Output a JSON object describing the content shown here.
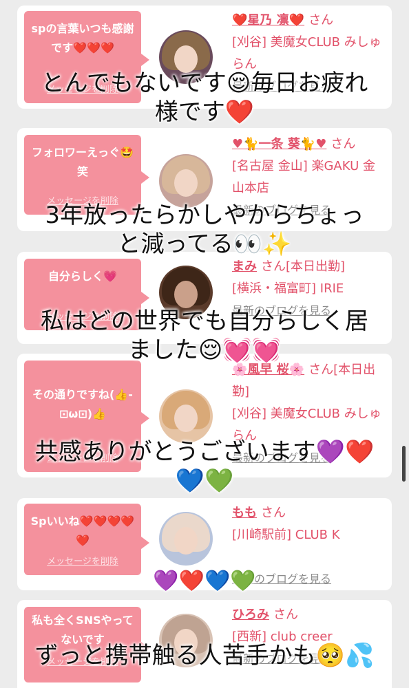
{
  "cards": [
    {
      "message": "spの言葉いつも感謝です❤️❤️❤️",
      "delete_label": "メッセージを削除",
      "name": "❤️星乃 凛❤️",
      "san": "さん",
      "shop": "[刈谷] 美魔女CLUB みしゅらん",
      "blog": "最新のブログを見る",
      "avatar_color": "#6a4b5c"
    },
    {
      "message": "フォロワーえっぐ🤩笑",
      "delete_label": "メッセージを削除",
      "name": "♥🐈一条 葵🐈♥",
      "san": "さん",
      "shop": "[名古屋 金山] 楽GAKU 金山本店",
      "blog": "最新のブログを見る",
      "avatar_color": "#c6a39b"
    },
    {
      "message": "自分らしく💗",
      "delete_label": "メッセージを削除",
      "name": "まみ",
      "san": "さん[本日出勤]",
      "shop": "[横浜・福富町] IRIE",
      "blog": "最新のブログを見る",
      "avatar_color": "#5a3a2a"
    },
    {
      "message": "その通りですね(👍-⊡ω⊡)👍",
      "delete_label": "メッセージを削除",
      "name": "🌸風早 桜🌸",
      "san": "さん[本日出勤]",
      "shop": "[刈谷] 美魔女CLUB みしゅらん",
      "blog": "最新のブログを見る",
      "avatar_color": "#e6c4a5"
    },
    {
      "message": "Spいいね❤️❤️❤️❤️❤️",
      "delete_label": "メッセージを削除",
      "name": "もも",
      "san": "さん",
      "shop": "[川崎駅前] CLUB K",
      "blog": "最新のブログを見る",
      "avatar_color": "#b8c4dc"
    },
    {
      "message": "私も全くSNSやってないです",
      "delete_label": "メッセージを削除",
      "name": "ひろみ",
      "san": "さん",
      "shop": "[西新] club creer",
      "blog": "最新のブログを見る",
      "avatar_color": "#d8c2b4"
    }
  ],
  "overlays": [
    "とんでもないです😌毎日お疲れ\n様です❤️",
    "3年放ったらかしやからちょっ\nと減ってる👀✨",
    "私はどの世界でも自分らしく居\nました😌💓💓",
    "共感ありがとうございます💜❤️\n💙💚",
    "💜❤️💙💚",
    "ずっと携帯触る人苦手かも🥺💦"
  ],
  "colors": {
    "accent": "#e2526a",
    "bubble": "#f4919d",
    "background": "#ececec"
  }
}
